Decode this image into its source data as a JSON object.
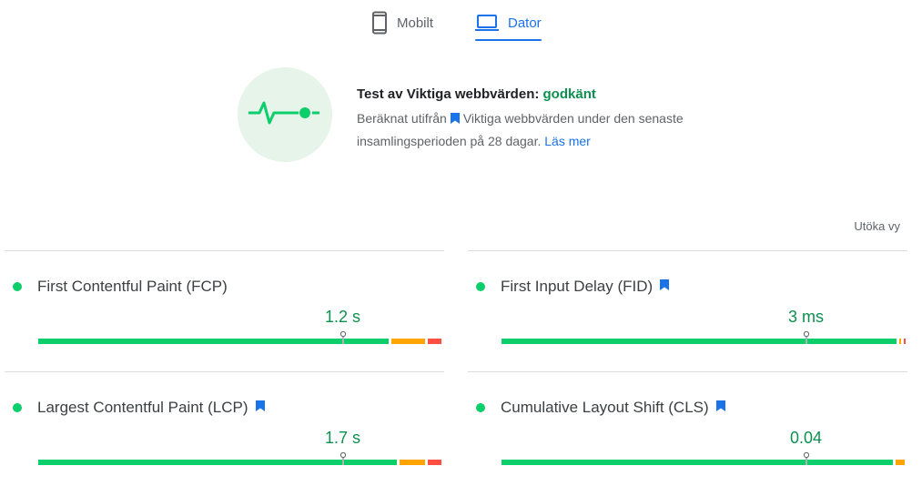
{
  "tabs": [
    {
      "label": "Mobilt",
      "icon": "smartphone-icon",
      "selected": false
    },
    {
      "label": "Dator",
      "icon": "laptop-icon",
      "selected": true
    }
  ],
  "summary": {
    "title_prefix": "Test av Viktiga webbvärden: ",
    "status": "godkänt",
    "desc_prefix": "Beräknat utifrån",
    "desc_suffix": "Viktiga webbvärden under den senaste insamlingsperioden på 28 dagar.",
    "learn_more": "Läs mer",
    "icon": "pulse-icon"
  },
  "expand_label": "Utöka vy",
  "colors": {
    "good": "#0cce6b",
    "average": "#ffa400",
    "poor": "#ff4e42",
    "accent": "#1a73e8",
    "pass_text": "#0d904f"
  },
  "metrics": [
    {
      "id": "fcp",
      "name": "First Contentful Paint (FCP)",
      "value": "1.2 s",
      "core": false,
      "marker": 0.75,
      "distribution": [
        0.87,
        0.09,
        0.04
      ]
    },
    {
      "id": "fid",
      "name": "First Input Delay (FID)",
      "value": "3 ms",
      "core": true,
      "marker": 0.75,
      "distribution": [
        0.98,
        0.01,
        0.01
      ]
    },
    {
      "id": "lcp",
      "name": "Largest Contentful Paint (LCP)",
      "value": "1.7 s",
      "core": true,
      "marker": 0.75,
      "distribution": [
        0.89,
        0.07,
        0.04
      ]
    },
    {
      "id": "cls",
      "name": "Cumulative Layout Shift (CLS)",
      "value": "0.04",
      "core": true,
      "marker": 0.75,
      "distribution": [
        0.97,
        0.03,
        0.0
      ]
    }
  ]
}
